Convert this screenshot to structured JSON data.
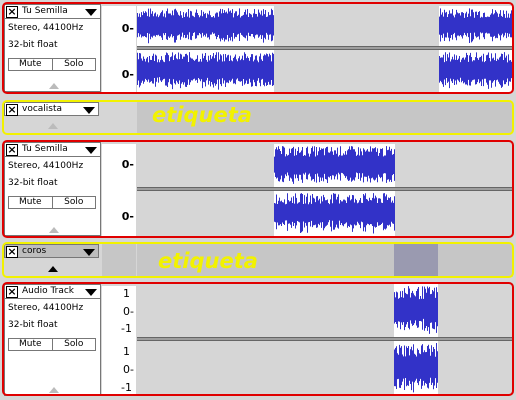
{
  "tracks": [
    {
      "type": "audio",
      "name": "Tu Semilla",
      "info1": "Stereo, 44100Hz",
      "info2": "32-bit float",
      "mute": "Mute",
      "solo": "Solo",
      "ruler": [
        "0-",
        "0-"
      ]
    },
    {
      "type": "label",
      "name": "vocalista",
      "label_text": "etiqueta"
    },
    {
      "type": "audio",
      "name": "Tu Semilla",
      "info1": "Stereo, 44100Hz",
      "info2": "32-bit float",
      "mute": "Mute",
      "solo": "Solo",
      "ruler": [
        "0-",
        "0-"
      ]
    },
    {
      "type": "label",
      "name": "coros",
      "label_text": "etiqueta"
    },
    {
      "type": "audio",
      "name": "Audio Track",
      "info1": "Stereo, 44100Hz",
      "info2": "32-bit float",
      "mute": "Mute",
      "solo": "Solo",
      "ruler": [
        "1",
        "0-",
        "-1",
        "1",
        "0-",
        "-1"
      ]
    }
  ],
  "colors": {
    "waveform": "#3232c8",
    "selection_outline_audio": "#e00000",
    "selection_outline_label": "#f2f200",
    "label_text": "#f2f200"
  }
}
